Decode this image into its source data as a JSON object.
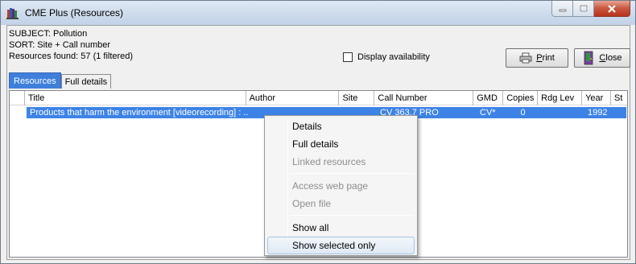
{
  "window": {
    "title": "CME Plus (Resources)"
  },
  "info": {
    "subject": "SUBJECT: Pollution",
    "sort": "SORT: Site + Call number",
    "found": "Resources found: 57  (1 filtered)"
  },
  "options": {
    "display_availability": "Display availability",
    "display_availability_checked": false
  },
  "buttons": {
    "print_u": "P",
    "print_rest": "rint",
    "close_u": "C",
    "close_rest": "lose"
  },
  "tabs": [
    {
      "label": "Resources",
      "active": true
    },
    {
      "label": "Full details",
      "active": false
    }
  ],
  "table": {
    "columns": [
      "Title",
      "Author",
      "Site",
      "Call Number",
      "GMD",
      "Copies",
      "Rdg Lev",
      "Year",
      "St"
    ],
    "rows": [
      {
        "title": "Products that harm the environment [videorecording] : ...",
        "author": "",
        "site": "",
        "call_number": "CV  363.7 PRO",
        "gmd": "CV*",
        "copies": "0",
        "rdg_lev": "",
        "year": "1992",
        "st": ""
      }
    ]
  },
  "context_menu": {
    "items": [
      {
        "label": "Details",
        "enabled": true
      },
      {
        "label": "Full details",
        "enabled": true
      },
      {
        "label": "Linked resources",
        "enabled": false
      },
      {
        "label": "Access web page",
        "enabled": false
      },
      {
        "label": "Open file",
        "enabled": false
      },
      {
        "label": "Show all",
        "enabled": true
      },
      {
        "label": "Show selected only",
        "enabled": true,
        "highlighted": true
      }
    ]
  },
  "colors": {
    "selection": "#3d83e6",
    "active_tab": "#3f7fdc"
  }
}
